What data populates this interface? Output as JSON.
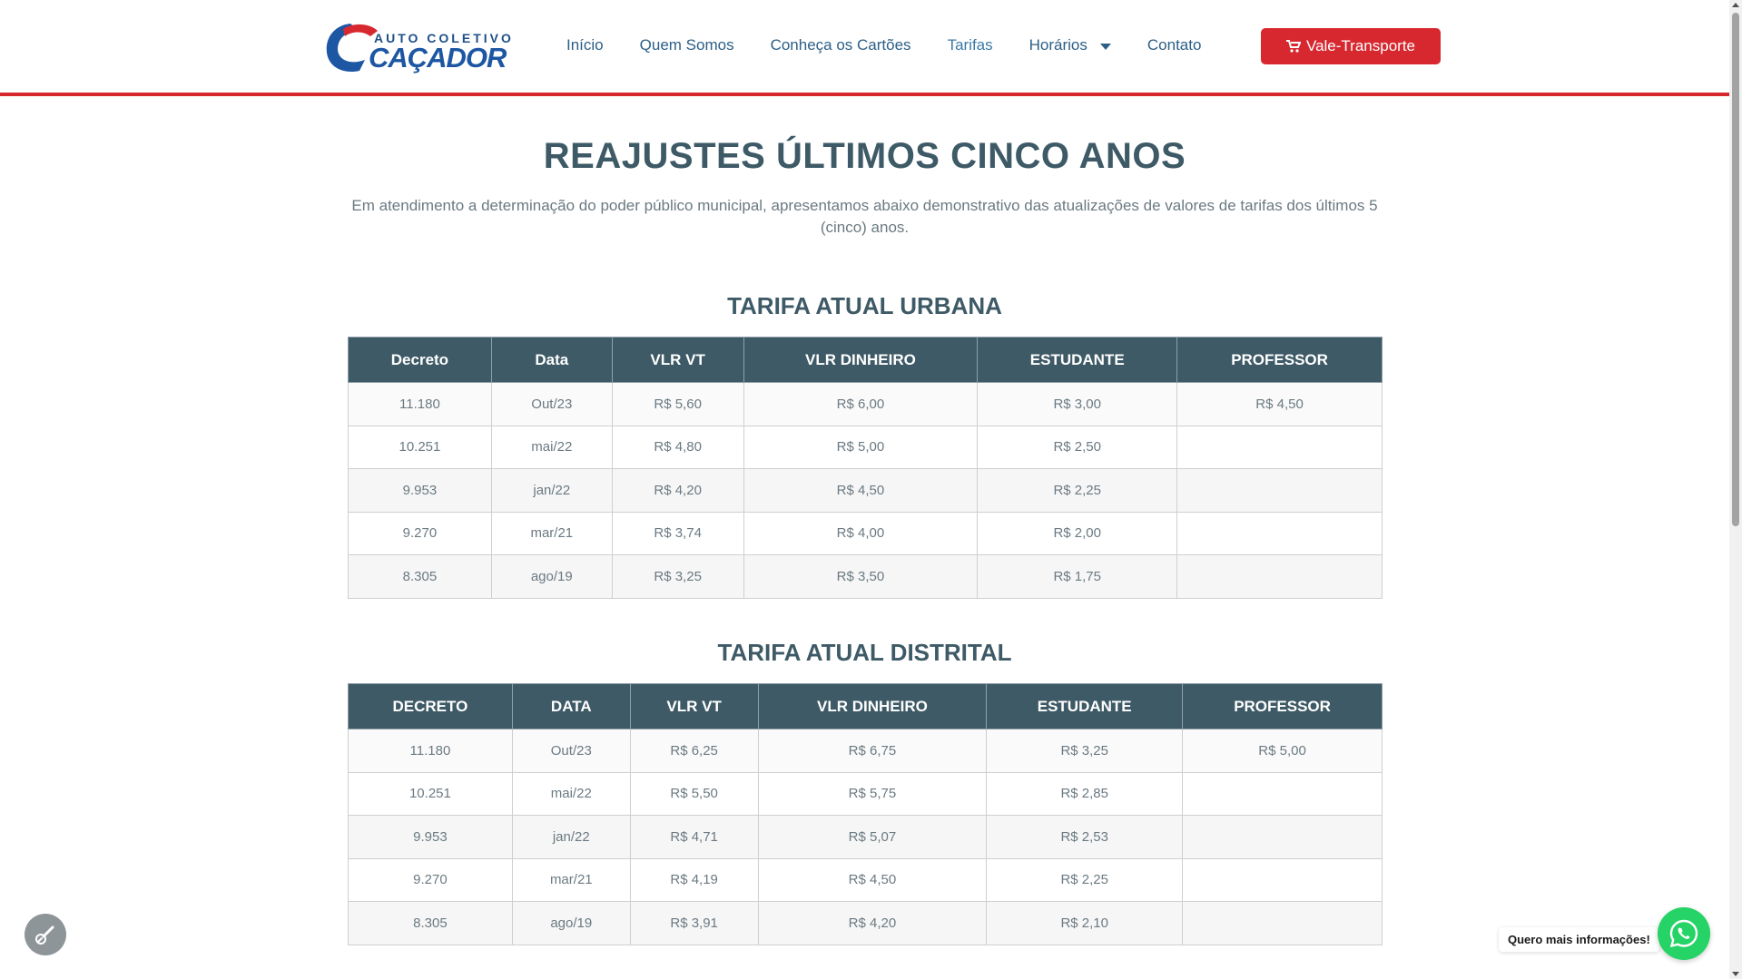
{
  "brand": {
    "top_text": "AUTO COLETIVO",
    "name": "CAÇADOR"
  },
  "nav": {
    "items": [
      {
        "label": "Início",
        "active": false
      },
      {
        "label": "Quem Somos",
        "active": false
      },
      {
        "label": "Conheça os Cartões",
        "active": false
      },
      {
        "label": "Tarifas",
        "active": true
      },
      {
        "label": "Horários",
        "active": false,
        "dropdown": true
      },
      {
        "label": "Contato",
        "active": false
      }
    ],
    "cta_label": "Vale-Transporte",
    "cta_icon": "cart-icon"
  },
  "colors": {
    "accent": "#d7282f",
    "header_table": "#3e5a66",
    "heading": "#3d5a66",
    "whatsapp": "#25d366"
  },
  "page": {
    "title": "REAJUSTES ÚLTIMOS CINCO ANOS",
    "intro": "Em atendimento a determinação do poder público municipal, apresentamos abaixo demonstrativo das atualizações de valores de tarifas dos últimos 5 (cinco) anos."
  },
  "urbana": {
    "title": "TARIFA ATUAL URBANA",
    "headers": [
      "Decreto",
      "Data",
      "VLR VT",
      "VLR DINHEIRO",
      "ESTUDANTE",
      "PROFESSOR"
    ],
    "rows": [
      [
        "11.180",
        "Out/23",
        "R$ 5,60",
        "R$ 6,00",
        "R$ 3,00",
        "R$ 4,50"
      ],
      [
        "10.251",
        "mai/22",
        "R$ 4,80",
        "R$ 5,00",
        "R$ 2,50",
        ""
      ],
      [
        "9.953",
        "jan/22",
        "R$ 4,20",
        "R$ 4,50",
        "R$ 2,25",
        ""
      ],
      [
        "9.270",
        "mar/21",
        "R$ 3,74",
        "R$ 4,00",
        "R$ 2,00",
        ""
      ],
      [
        "8.305",
        "ago/19",
        "R$ 3,25",
        "R$ 3,50",
        "R$ 1,75",
        ""
      ]
    ]
  },
  "distrital": {
    "title": "TARIFA ATUAL DISTRITAL",
    "headers": [
      "DECRETO",
      "DATA",
      "VLR VT",
      "VLR DINHEIRO",
      "ESTUDANTE",
      "PROFESSOR"
    ],
    "rows": [
      [
        "11.180",
        "Out/23",
        "R$ 6,25",
        "R$ 6,75",
        "R$ 3,25",
        "R$ 5,00"
      ],
      [
        "10.251",
        "mai/22",
        "R$ 5,50",
        "R$ 5,75",
        "R$ 2,85",
        ""
      ],
      [
        "9.953",
        "jan/22",
        "R$ 4,71",
        "R$ 5,07",
        "R$ 2,53",
        ""
      ],
      [
        "9.270",
        "mar/21",
        "R$ 4,19",
        "R$ 4,50",
        "R$ 2,25",
        ""
      ],
      [
        "8.305",
        "ago/19",
        "R$ 3,91",
        "R$ 4,20",
        "R$ 2,10",
        ""
      ]
    ]
  },
  "widgets": {
    "whatsapp_label": "Quero mais informações!",
    "whatsapp_icon": "whatsapp-icon",
    "accessibility_icon": "accessibility-icon"
  }
}
